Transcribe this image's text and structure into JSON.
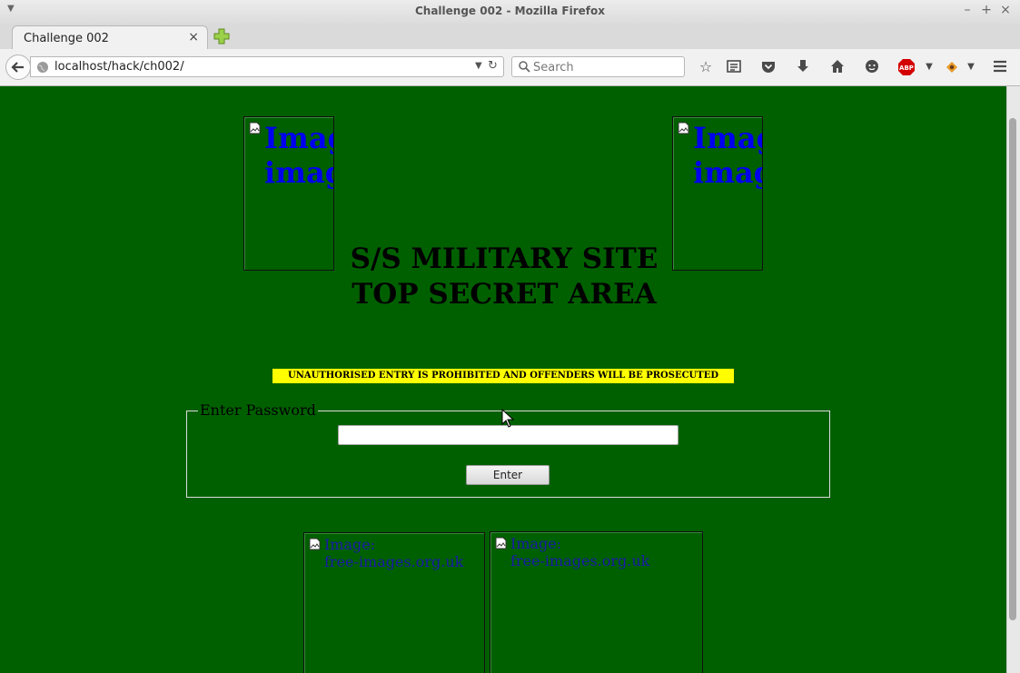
{
  "window": {
    "title": "Challenge 002 - Mozilla Firefox",
    "controls": [
      "–",
      "+",
      "×"
    ]
  },
  "tab": {
    "label": "Challenge 002",
    "close": "×"
  },
  "navbar": {
    "url": "localhost/hack/ch002/",
    "search_placeholder": "Search",
    "icons": [
      "star-icon",
      "reading-list-icon",
      "pocket-icon",
      "download-icon",
      "home-icon",
      "chat-icon",
      "adblock-icon",
      "extension-icon",
      "menu-icon"
    ],
    "adblock_label": "ABP"
  },
  "page": {
    "bg_color": "#006000",
    "image_alt_big": "Image: free-images.org.uk",
    "image_alt_small_line1": "Image:",
    "image_alt_small_line2": "free-images.org.uk",
    "heading_line1": "S/S MILITARY SITE",
    "heading_line2": "TOP SECRET AREA",
    "warning": "UNAUTHORISED ENTRY IS PROHIBITED AND OFFENDERS WILL BE PROSECUTED",
    "legend": "Enter Password",
    "password_value": "",
    "enter_button": "Enter"
  }
}
